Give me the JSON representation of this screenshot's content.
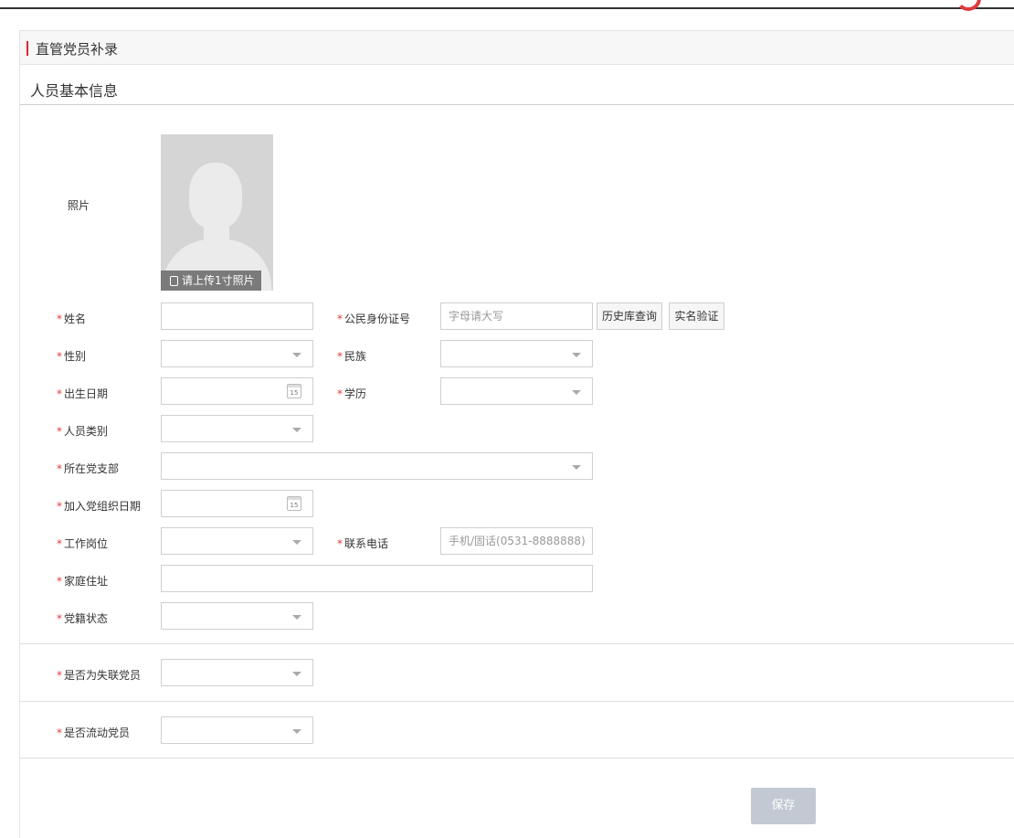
{
  "panel": {
    "title": "直管党员补录"
  },
  "section": {
    "title": "人员基本信息"
  },
  "photo": {
    "label": "照片",
    "upload_text": "请上传1寸照片"
  },
  "fields": {
    "name": {
      "label": "姓名"
    },
    "id_number": {
      "label": "公民身份证号",
      "placeholder": "字母请大写"
    },
    "gender": {
      "label": "性别"
    },
    "ethnicity": {
      "label": "民族"
    },
    "birth_date": {
      "label": "出生日期"
    },
    "education": {
      "label": "学历"
    },
    "person_type": {
      "label": "人员类别"
    },
    "party_branch": {
      "label": "所在党支部"
    },
    "join_date": {
      "label": "加入党组织日期"
    },
    "job_position": {
      "label": "工作岗位"
    },
    "phone": {
      "label": "联系电话",
      "placeholder": "手机/固话(0531-8888888)"
    },
    "home_address": {
      "label": "家庭住址"
    },
    "membership_status": {
      "label": "党籍状态"
    },
    "lost_contact": {
      "label": "是否为失联党员"
    },
    "floating": {
      "label": "是否流动党员"
    }
  },
  "required_mark": "*",
  "calendar_day": "15",
  "buttons": {
    "history": "历史库查询",
    "verify": "实名验证",
    "save": "保存"
  }
}
